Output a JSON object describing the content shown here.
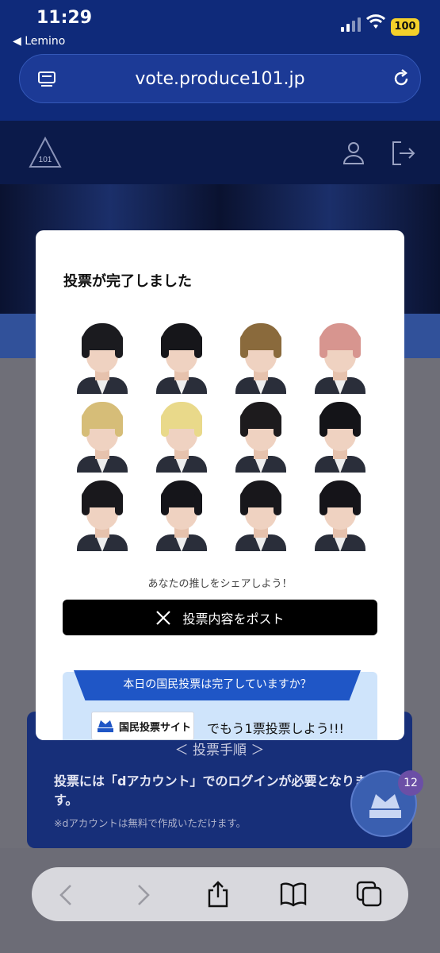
{
  "status": {
    "time": "11:29",
    "back_app": "◀ Lemino",
    "battery": "100"
  },
  "browser": {
    "url": "vote.produce101.jp"
  },
  "modal": {
    "title": "投票が完了しました",
    "share_hint": "あなたの推しをシェアしよう！",
    "post_button": "投票内容をポスト",
    "national": {
      "ribbon": "本日の国民投票は完了していますか？",
      "site_button": "国民投票サイト",
      "cta": "でもう1票投票しよう!!!"
    }
  },
  "page": {
    "vote_steps_title": "＜ 投票手順 ＞",
    "vote_steps_text": "投票には「dアカウント」でのログインが必要となります。",
    "vote_steps_note": "※dアカウントは無料で作成いただけます。"
  },
  "fab_badge": "12",
  "colors": {
    "header": "#0b1a4a",
    "accent": "#1f56c6",
    "browser": "#0f2a7a"
  }
}
